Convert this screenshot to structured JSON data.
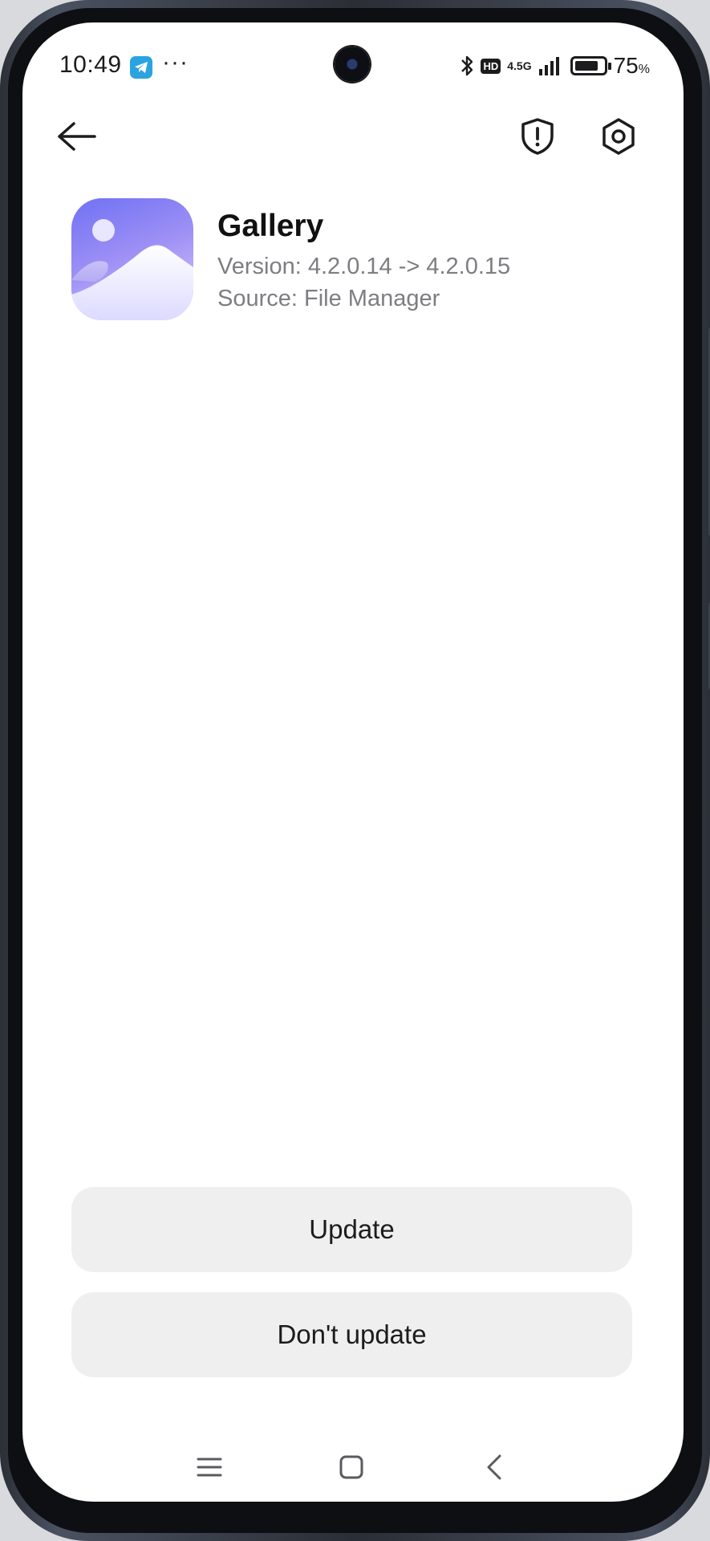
{
  "status_bar": {
    "time": "10:49",
    "more": "···",
    "hd": "HD",
    "network": "4.5G",
    "battery": "75",
    "battery_unit": "%"
  },
  "toolbar": {
    "back_icon": "back-arrow-icon",
    "security_icon": "shield-alert-icon",
    "settings_icon": "gear-icon"
  },
  "app": {
    "name": "Gallery",
    "version": "Version: 4.2.0.14 -> 4.2.0.15",
    "source": "Source: File Manager",
    "icon": "gallery-icon"
  },
  "actions": {
    "update_label": "Update",
    "dont_update_label": "Don't update"
  },
  "colors": {
    "button_bg": "#efefef",
    "secondary_text": "#7d7d82",
    "icon_gradient_top": "#7b7cf6",
    "icon_gradient_bottom": "#e9e8ff"
  }
}
